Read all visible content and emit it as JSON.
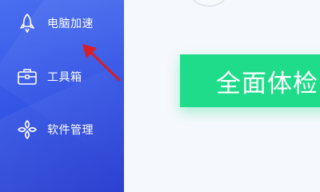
{
  "sidebar": {
    "items": [
      {
        "label": "电脑加速",
        "icon": "rocket-icon"
      },
      {
        "label": "工具箱",
        "icon": "toolbox-icon"
      },
      {
        "label": "软件管理",
        "icon": "software-management-icon"
      }
    ]
  },
  "main": {
    "scan_button_label": "全面体检"
  },
  "colors": {
    "sidebar_top": "#4a6ff0",
    "sidebar_bottom": "#2a3fcf",
    "scan_button": "#1fdc8a",
    "background": "#f5f8fc",
    "arrow": "#d61f26"
  }
}
